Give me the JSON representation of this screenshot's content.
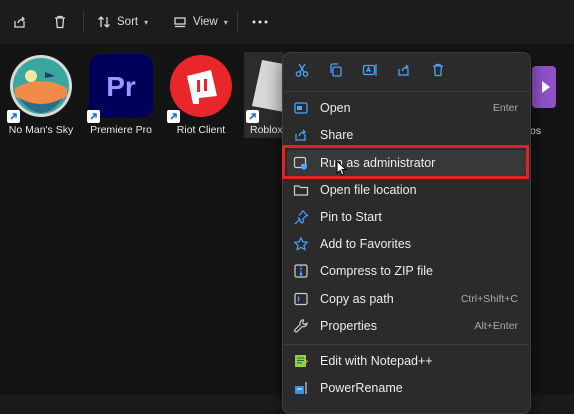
{
  "toolbar": {
    "share_icon": "share-icon",
    "delete_icon": "trash-icon",
    "sort_label": "Sort",
    "view_label": "View",
    "more_icon": "more-icon"
  },
  "files": [
    {
      "label": "No Man's Sky",
      "icon": "no-mans-sky-app-icon"
    },
    {
      "label": "Premiere Pro",
      "icon": "premiere-pro-app-icon",
      "glyph": "Pr"
    },
    {
      "label": "Riot Client",
      "icon": "riot-client-app-icon"
    },
    {
      "label": "Roblox",
      "icon": "roblox-app-icon"
    },
    {
      "label": "os",
      "icon": "video-app-icon"
    }
  ],
  "context_menu": {
    "quick_actions": [
      "cut-icon",
      "copy-icon",
      "rename-icon",
      "share-icon",
      "delete-icon"
    ],
    "items": [
      {
        "label": "Open",
        "shortcut": "Enter",
        "icon": "open-icon"
      },
      {
        "label": "Share",
        "shortcut": "",
        "icon": "share-icon"
      },
      {
        "label": "Run as administrator",
        "shortcut": "",
        "icon": "shield-window-icon"
      },
      {
        "label": "Open file location",
        "shortcut": "",
        "icon": "folder-icon"
      },
      {
        "label": "Pin to Start",
        "shortcut": "",
        "icon": "pin-icon"
      },
      {
        "label": "Add to Favorites",
        "shortcut": "",
        "icon": "star-icon"
      },
      {
        "label": "Compress to ZIP file",
        "shortcut": "",
        "icon": "zip-icon"
      },
      {
        "label": "Copy as path",
        "shortcut": "Ctrl+Shift+C",
        "icon": "path-icon"
      },
      {
        "label": "Properties",
        "shortcut": "Alt+Enter",
        "icon": "wrench-icon"
      },
      {
        "label": "Edit with Notepad++",
        "shortcut": "",
        "icon": "notepad-plus-plus-icon"
      },
      {
        "label": "PowerRename",
        "shortcut": "",
        "icon": "power-rename-icon"
      }
    ]
  },
  "colors": {
    "highlight_border": "#e52222",
    "menu_bg": "#2b2b2b",
    "accent_blue": "#4aa3ff"
  }
}
